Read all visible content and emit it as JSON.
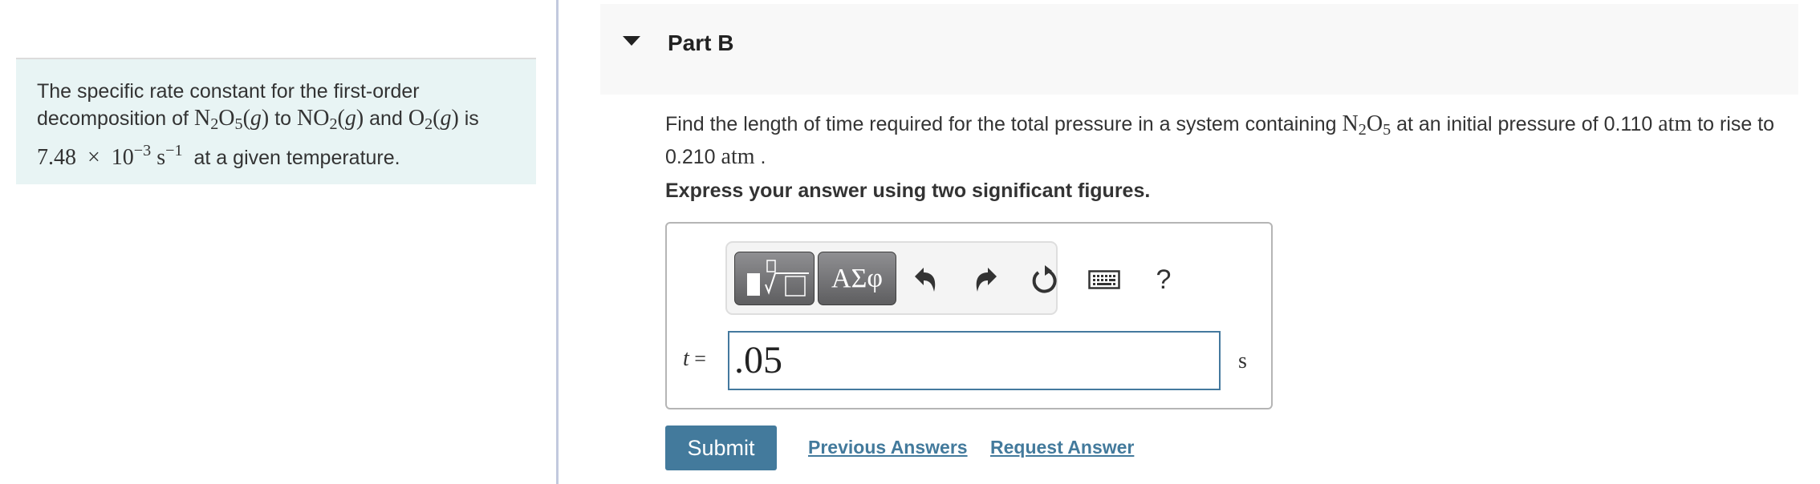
{
  "intro": {
    "text_1": "The specific rate constant for the first-order decomposition of",
    "reactant": {
      "base": "N",
      "sub1": "2",
      "base2": "O",
      "sub2": "5",
      "phase": "g"
    },
    "text_2": "to",
    "product_1": {
      "base": "NO",
      "sub": "2",
      "phase": "g"
    },
    "text_3": "and",
    "product_2": {
      "base": "O",
      "sub": "2",
      "phase": "g"
    },
    "text_4": "is",
    "rate_constant": {
      "mantissa": "7.48",
      "times": "×",
      "base": "10",
      "exponent": "−3",
      "unit": "s",
      "unit_exponent": "−1"
    },
    "text_5": "at a given temperature."
  },
  "part": {
    "title": "Part B",
    "toggle_icon": "caret-down-icon"
  },
  "question": {
    "text_1": "Find the length of time required for the total pressure in a system containing",
    "species": {
      "base": "N",
      "sub1": "2",
      "base2": "O",
      "sub2": "5"
    },
    "text_2": "at an initial pressure of",
    "initial_pressure": "0.110",
    "pressure_unit": "atm",
    "text_3": "to rise to",
    "final_pressure": "0.210",
    "text_4": "."
  },
  "instruction": "Express your answer using two significant figures.",
  "toolbar": {
    "templates_icon": "templates-icon",
    "symbols_label": "ΑΣφ",
    "undo_icon": "undo-icon",
    "redo_icon": "redo-icon",
    "reset_icon": "reset-icon",
    "keyboard_icon": "keyboard-icon",
    "help_label": "?"
  },
  "answer": {
    "variable": "t",
    "equals": "=",
    "value": ".05",
    "unit": "s"
  },
  "actions": {
    "submit_label": "Submit",
    "previous_answers_label": "Previous Answers",
    "request_answer_label": "Request Answer"
  },
  "colors": {
    "primary": "#437a9c",
    "intro_bg": "#e8f4f4",
    "part_header_bg": "#f8f8f8",
    "divider": "#c2c9de"
  }
}
